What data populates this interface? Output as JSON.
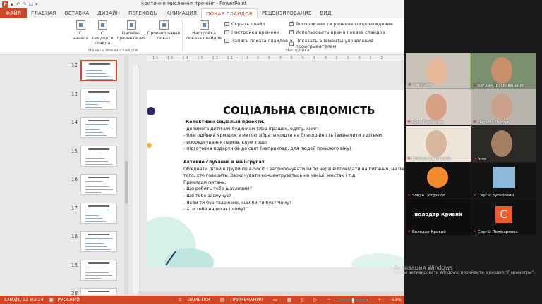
{
  "window": {
    "title": "критичне мислення_тренінг - PowerPoint",
    "app_icon": "P"
  },
  "tabs": [
    {
      "label": "ФАЙЛ"
    },
    {
      "label": "ГЛАВНАЯ"
    },
    {
      "label": "ВСТАВКА"
    },
    {
      "label": "ДИЗАЙН"
    },
    {
      "label": "ПЕРЕХОДЫ"
    },
    {
      "label": "АНИМАЦИЯ"
    },
    {
      "label": "ПОКАЗ СЛАЙДОВ"
    },
    {
      "label": "РЕЦЕНЗИРОВАНИЕ"
    },
    {
      "label": "ВИД"
    }
  ],
  "ribbon": {
    "from_start": "С\nначала",
    "from_current": "С текущего\nслайда",
    "online": "Онлайн-\nпрезентация",
    "custom": "Произвольный\nпоказ",
    "setup": "Настройка\nпоказа слайдов",
    "hide": "Скрыть слайд",
    "rehearse": "Настройка времени",
    "record": "Запись показа слайдов",
    "play_narr": "Воспроизвести речевое сопровождение",
    "use_timings": "Использовать время показа слайдов",
    "show_controls": "Показать элементы управления проигрывателем",
    "group_start": "Начать показ слайдов",
    "group_setup": "Настройка"
  },
  "ruler": "16 · 15 · 14 · 13 · 12 · 11 · 10 · 9 · 8 · 7 · 6 · 5 · 4 · 3 · 2 · 1 · 0 · 1 · 2",
  "thumbnails": [
    {
      "num": "12"
    },
    {
      "num": "13"
    },
    {
      "num": "14"
    },
    {
      "num": "15"
    },
    {
      "num": "16"
    },
    {
      "num": "17"
    },
    {
      "num": "18"
    },
    {
      "num": "19"
    },
    {
      "num": "20"
    }
  ],
  "slide": {
    "title": "СОЦІАЛЬНА СВІДОМІСТЬ",
    "lines": [
      {
        "text": "Колективні соціальні проекти.",
        "bold": true
      },
      {
        "text": "- допомога дитячим будинкам (збір іграшок, одягу, книг)",
        "bold": false
      },
      {
        "text": "- благодійний ярмарок з метою зібрати кошти на благодійність (визначити з дітьми)",
        "bold": false
      },
      {
        "text": "- впорядкування парків, клум тощо",
        "bold": false
      },
      {
        "text": "- підготовка подарунків до свят (наприклад, для людей похилого віку)",
        "bold": false
      },
      {
        "text": "",
        "bold": false
      },
      {
        "text": "Активне слухання в міні-групах",
        "bold": true
      },
      {
        "text": "Об'єднати дітей в групи по 4-5осіб і запропонувати їм по черзі відповідати на питання, не переб",
        "bold": false
      },
      {
        "text": "того, хто говорить. Заохочувати концентруватись на міміці, жестах і т.д",
        "bold": false
      },
      {
        "text": "Приклади питань:",
        "bold": false
      },
      {
        "text": "- Що робить тебе щасливим?",
        "bold": false
      },
      {
        "text": "- Що тебе засмучує?",
        "bold": false
      },
      {
        "text": "- Якби ти був твариною, ким би ти був? Чому?",
        "bold": false
      },
      {
        "text": "- Хто тебе надихає і чому?",
        "bold": false
      }
    ]
  },
  "status": {
    "slide_info": "СЛАЙД 12 ИЗ 24",
    "language": "РУССКИЙ",
    "notes": "ЗАМЕТКИ",
    "comments": "ПРИМЕЧАНИЯ",
    "zoom": "63%"
  },
  "participants": [
    {
      "name": "Катерина"
    },
    {
      "name": "Богдан Трускавецький"
    },
    {
      "name": "Юлія Гребенюк"
    },
    {
      "name": "Наталія Левчук"
    },
    {
      "name": "Оленка Шапошник"
    },
    {
      "name": "Інна"
    },
    {
      "name": "Sonya Dorgovich"
    },
    {
      "name": "Сергій Зубарович"
    },
    {
      "name": "Володар Кривий",
      "display": "Володар Кривий"
    },
    {
      "name": "Сергій Полікарпова",
      "letter": "С"
    }
  ],
  "watermark": {
    "title": "Активация Windows",
    "sub": "Чтобы активировать Windows, перейдите в раздел \"Параметры\"."
  },
  "colors": {
    "accent": "#d24726",
    "slide_navy": "#2e2c66",
    "slide_teal": "#bfe7dd",
    "zoom_orange": "#f05a28"
  }
}
